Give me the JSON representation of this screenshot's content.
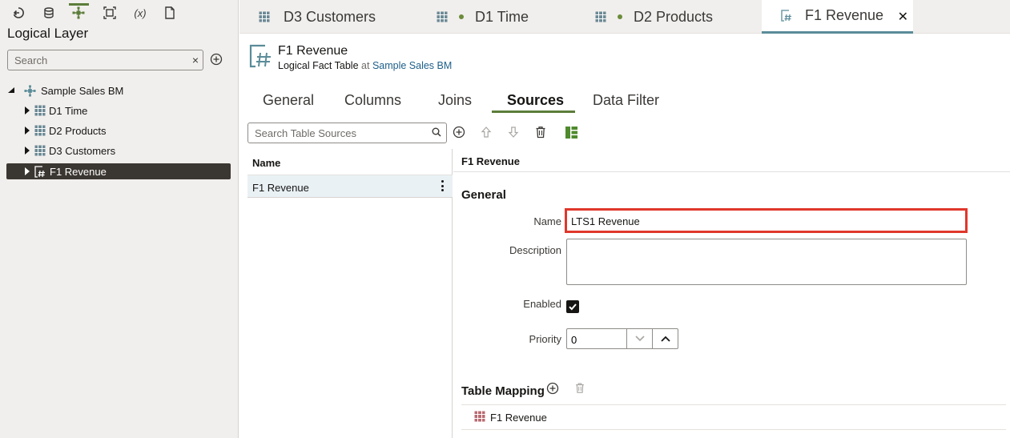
{
  "colors": {
    "accent_green": "#5c7d3a",
    "accent_teal": "#5b8c99",
    "link": "#1e5f8a",
    "highlight_red": "#e0372b",
    "selected_row": "#3a3631",
    "fact_icon": "#b86b72"
  },
  "toolbar": {
    "icons": [
      "back-icon",
      "database-icon",
      "logical-model-icon",
      "frame-icon",
      "expression-icon",
      "document-icon"
    ],
    "expression_label": "(x)"
  },
  "left_panel": {
    "title": "Logical Layer",
    "search": {
      "placeholder": "Search",
      "value": "",
      "clear": "×"
    },
    "tree": {
      "root": {
        "label": "Sample Sales BM"
      },
      "items": [
        {
          "label": "D1 Time",
          "icon": "dimension-table-icon"
        },
        {
          "label": "D2 Products",
          "icon": "dimension-table-icon"
        },
        {
          "label": "D3 Customers",
          "icon": "dimension-table-icon"
        },
        {
          "label": "F1 Revenue",
          "icon": "fact-table-icon",
          "selected": true
        }
      ]
    }
  },
  "tabs": [
    {
      "label": "D3 Customers",
      "icon": "dimension-table-icon",
      "dot": false
    },
    {
      "label": "D1 Time",
      "icon": "dimension-table-icon",
      "dot": true
    },
    {
      "label": "D2 Products",
      "icon": "dimension-table-icon",
      "dot": true
    },
    {
      "label": "F1 Revenue",
      "icon": "fact-table-icon",
      "active": true,
      "close": "✕"
    }
  ],
  "header": {
    "title": "F1 Revenue",
    "type": "Logical Fact Table",
    "at": "at",
    "model_link": "Sample Sales BM"
  },
  "subtabs": [
    {
      "label": "General"
    },
    {
      "label": "Columns"
    },
    {
      "label": "Joins"
    },
    {
      "label": "Sources",
      "active": true
    },
    {
      "label": "Data Filter"
    }
  ],
  "sources": {
    "search": {
      "placeholder": "Search Table Sources",
      "value": ""
    },
    "list": {
      "header": "Name",
      "rows": [
        {
          "label": "F1 Revenue",
          "selected": true
        }
      ]
    }
  },
  "detail": {
    "title": "F1 Revenue",
    "section_general": "General",
    "fields": {
      "name": {
        "label": "Name",
        "value": "LTS1 Revenue"
      },
      "description": {
        "label": "Description",
        "value": ""
      },
      "enabled": {
        "label": "Enabled",
        "checked": true
      },
      "priority": {
        "label": "Priority",
        "value": "0"
      }
    },
    "table_mapping": {
      "title": "Table Mapping",
      "rows": [
        {
          "label": "F1 Revenue",
          "icon": "physical-table-icon"
        }
      ]
    }
  }
}
